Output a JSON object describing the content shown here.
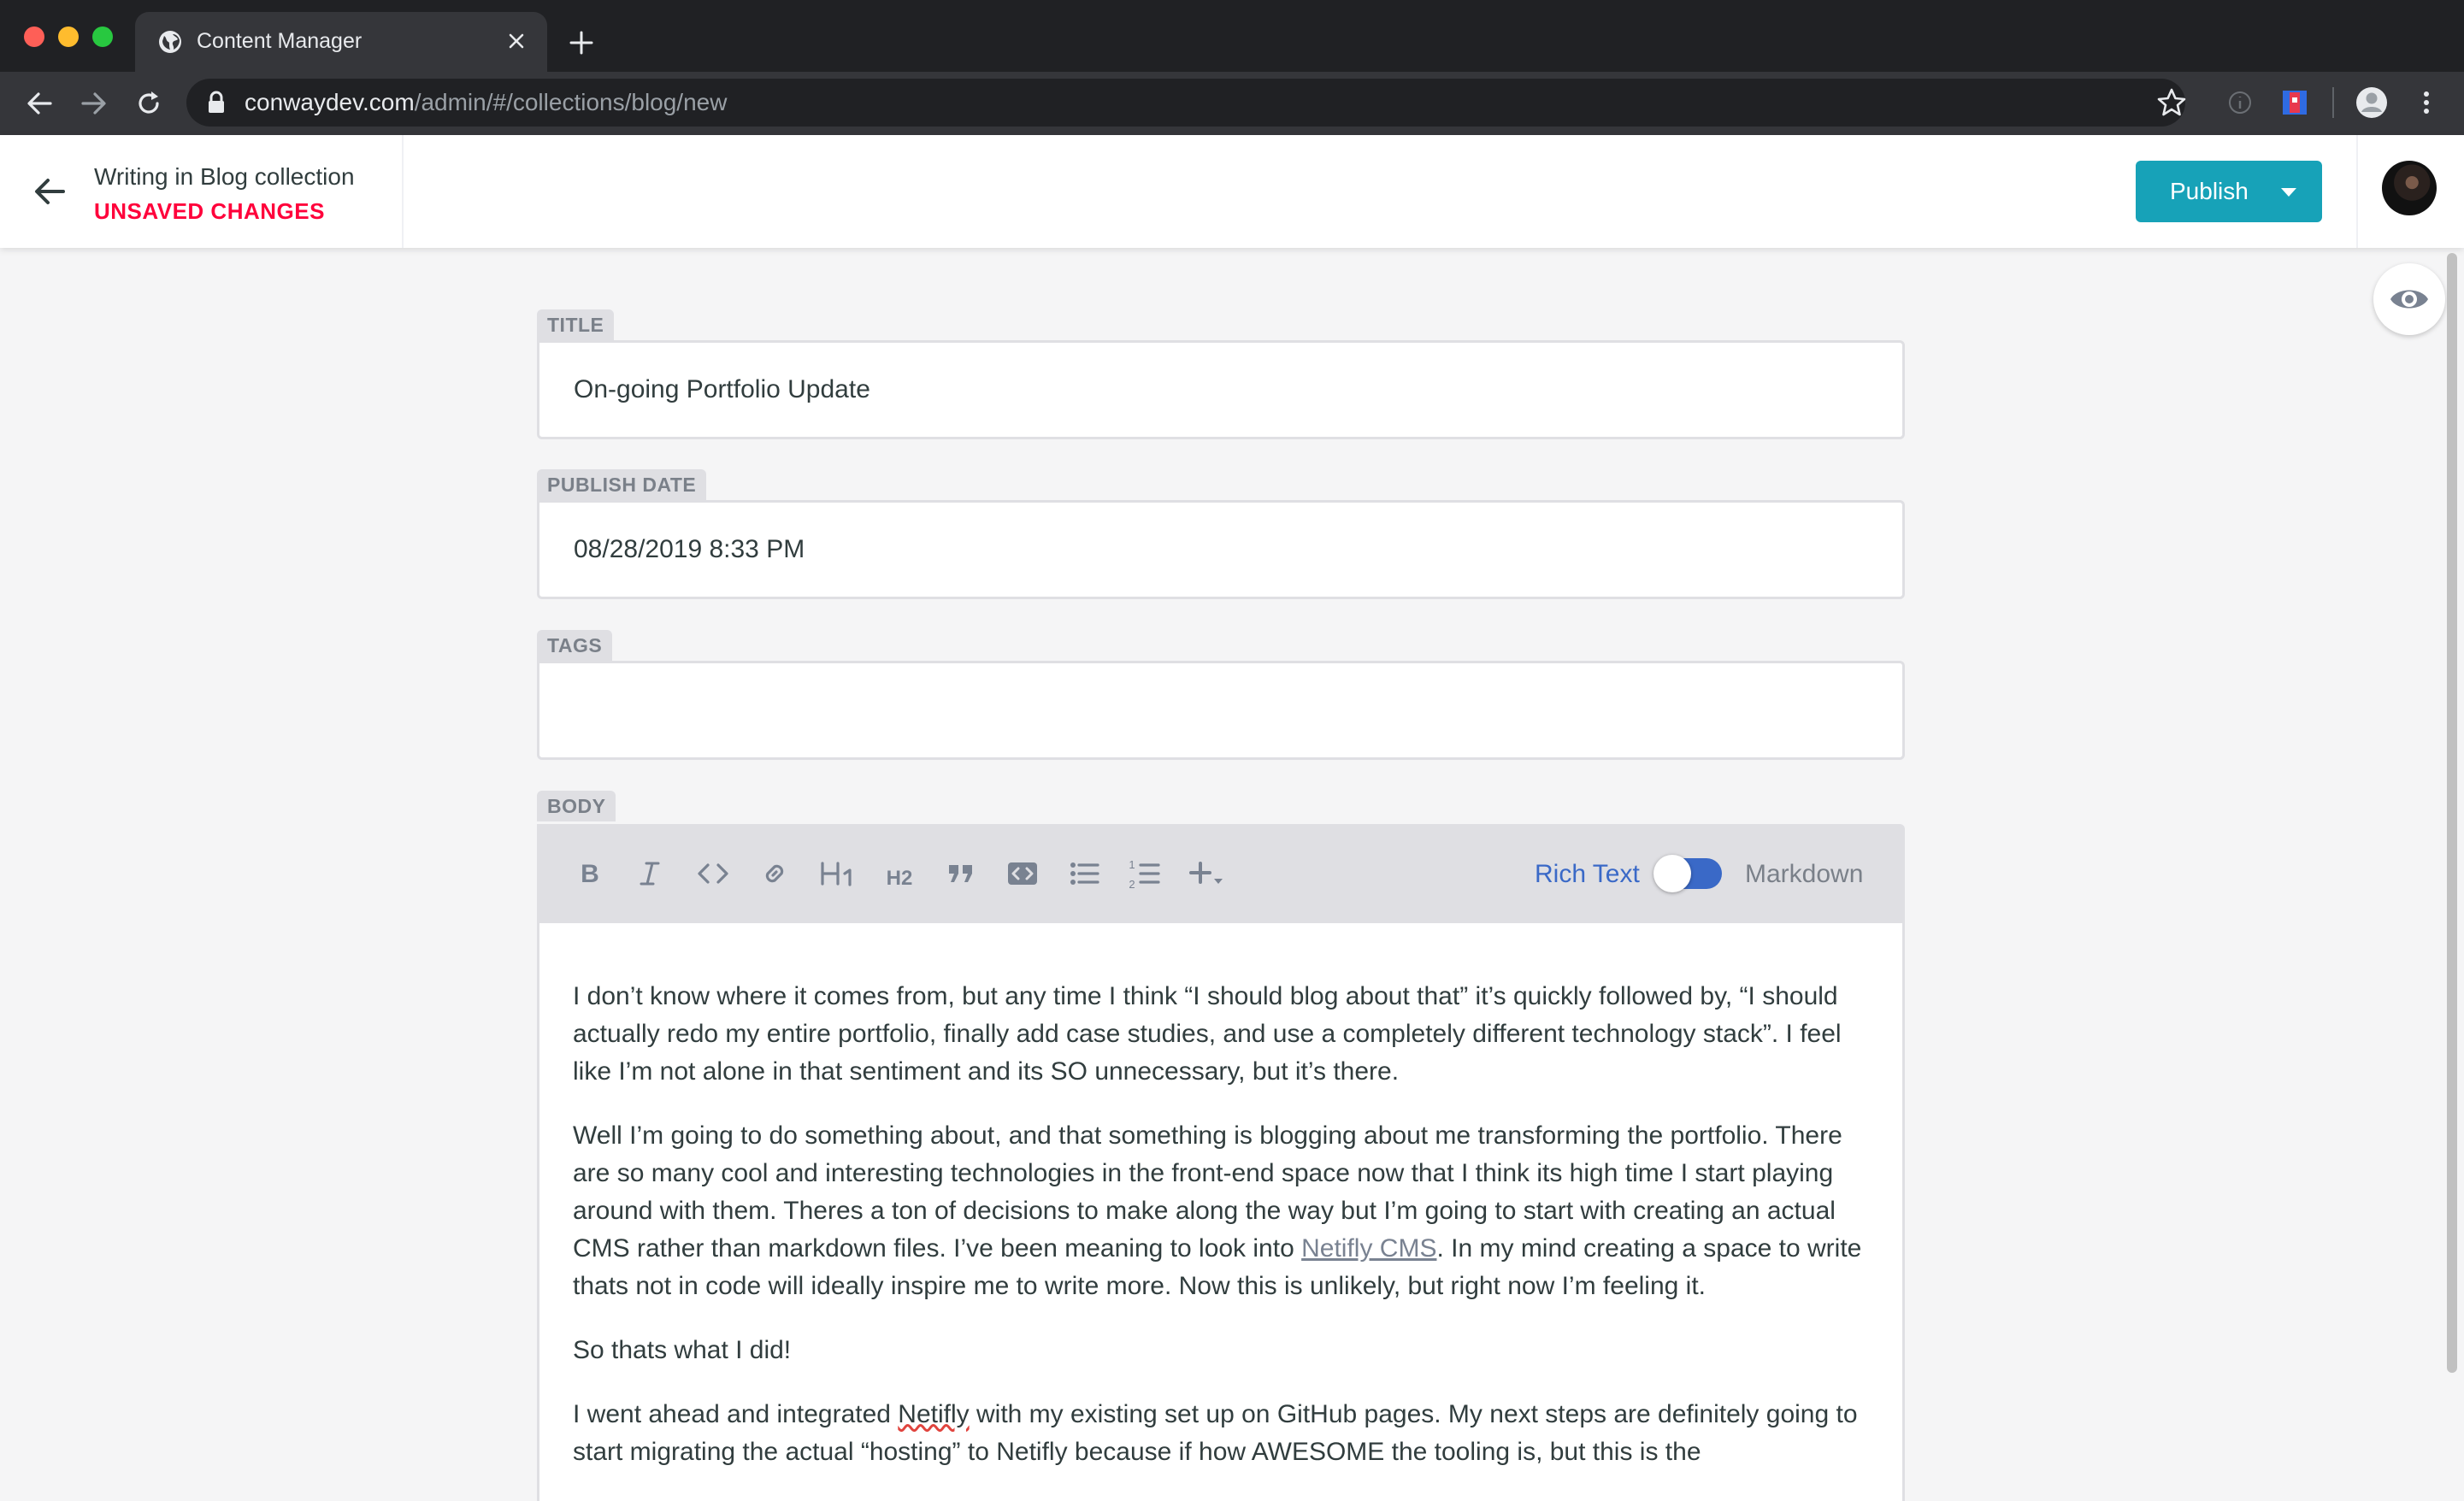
{
  "browser": {
    "tab_title": "Content Manager",
    "url_host": "conwaydev.com",
    "url_path": "/admin/#/collections/blog/new"
  },
  "app": {
    "collection_label": "Writing in Blog collection",
    "status": "UNSAVED CHANGES",
    "publish_label": "Publish"
  },
  "fields": {
    "title": {
      "label": "TITLE",
      "value": "On-going Portfolio Update"
    },
    "publish_date": {
      "label": "PUBLISH DATE",
      "value": "08/28/2019 8:33 PM"
    },
    "tags": {
      "label": "TAGS",
      "value": ""
    },
    "body": {
      "label": "BODY"
    }
  },
  "editor": {
    "toolbar_icons": [
      "bold-icon",
      "italic-icon",
      "code-icon",
      "link-icon",
      "heading1-icon",
      "heading2-icon",
      "quote-icon",
      "code-block-icon",
      "bulleted-list-icon",
      "numbered-list-icon",
      "add-component-icon"
    ],
    "mode_rich": "Rich Text",
    "mode_markdown": "Markdown",
    "rich_text_enabled": true
  },
  "body": {
    "p1": "I don’t know where it comes from, but any time I think “I should blog about that” it’s quickly followed by, “I should actually redo my entire portfolio, finally add case studies, and use a completely different technology stack”. I feel like I’m not alone in that sentiment and its SO unnecessary, but it’s there.",
    "p2_before": "Well I’m going to do something about, and that something is blogging about me transforming the portfolio. There are so many cool and interesting technologies in the front-end space now that I think its high time I start playing around with them. Theres a ton of decisions to make along the way but I’m going to start with creating an actual CMS rather than markdown files. I’ve been meaning to look into ",
    "p2_link": "Netifly CMS",
    "p2_after": ". In my mind creating a space to write thats not in code will ideally inspire me to write more. Now this is unlikely, but right now I’m feeling it.",
    "p3": "So thats what I did!",
    "p4_before": "I went ahead and integrated ",
    "p4_word": "Netifly",
    "p4_after": " with my existing set up on GitHub pages. My next steps are definitely going to start migrating the actual “hosting” to Netifly because if how AWESOME the tooling is, but this is the"
  },
  "colors": {
    "brand": "#17a2b8",
    "unsaved": "#ff003b",
    "toggle": "#3a69c7",
    "text": "#313d3e"
  }
}
